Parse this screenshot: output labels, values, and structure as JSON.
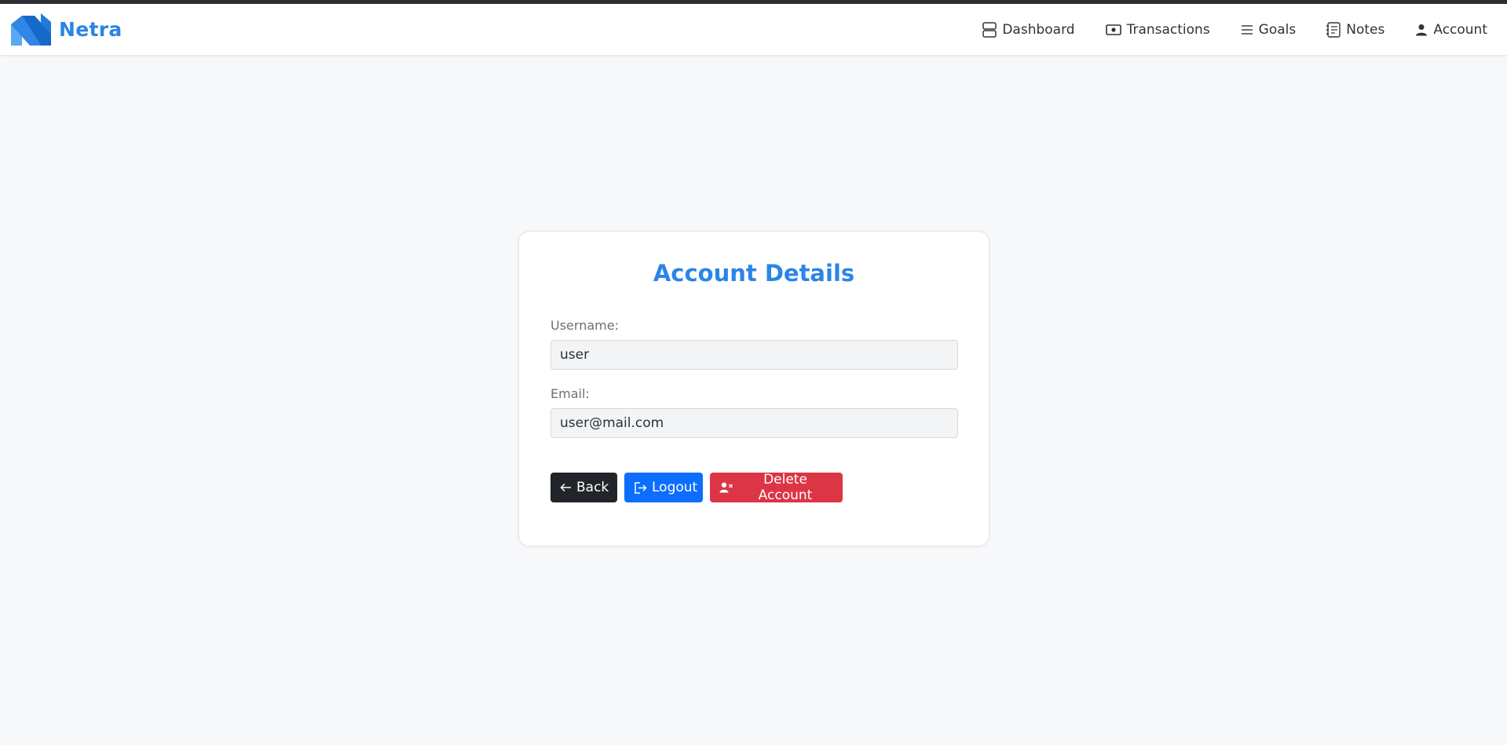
{
  "brand": {
    "name": "Netra",
    "color": "#2a85e6"
  },
  "nav": {
    "items": [
      {
        "label": "Dashboard",
        "icon": "dashboard-icon"
      },
      {
        "label": "Transactions",
        "icon": "cash-icon"
      },
      {
        "label": "Goals",
        "icon": "list-icon"
      },
      {
        "label": "Notes",
        "icon": "notes-icon"
      },
      {
        "label": "Account",
        "icon": "user-icon"
      }
    ]
  },
  "card": {
    "title": "Account Details",
    "username": {
      "label": "Username:",
      "value": "user"
    },
    "email": {
      "label": "Email:",
      "value": "user@mail.com"
    },
    "buttons": {
      "back": {
        "label": "Back",
        "icon": "arrow-left-icon",
        "color": "#212529"
      },
      "logout": {
        "label": "Logout",
        "icon": "logout-icon",
        "color": "#0d6efd"
      },
      "delete": {
        "label": "Delete Account",
        "icon": "user-remove-icon",
        "color": "#dc3545"
      }
    }
  }
}
